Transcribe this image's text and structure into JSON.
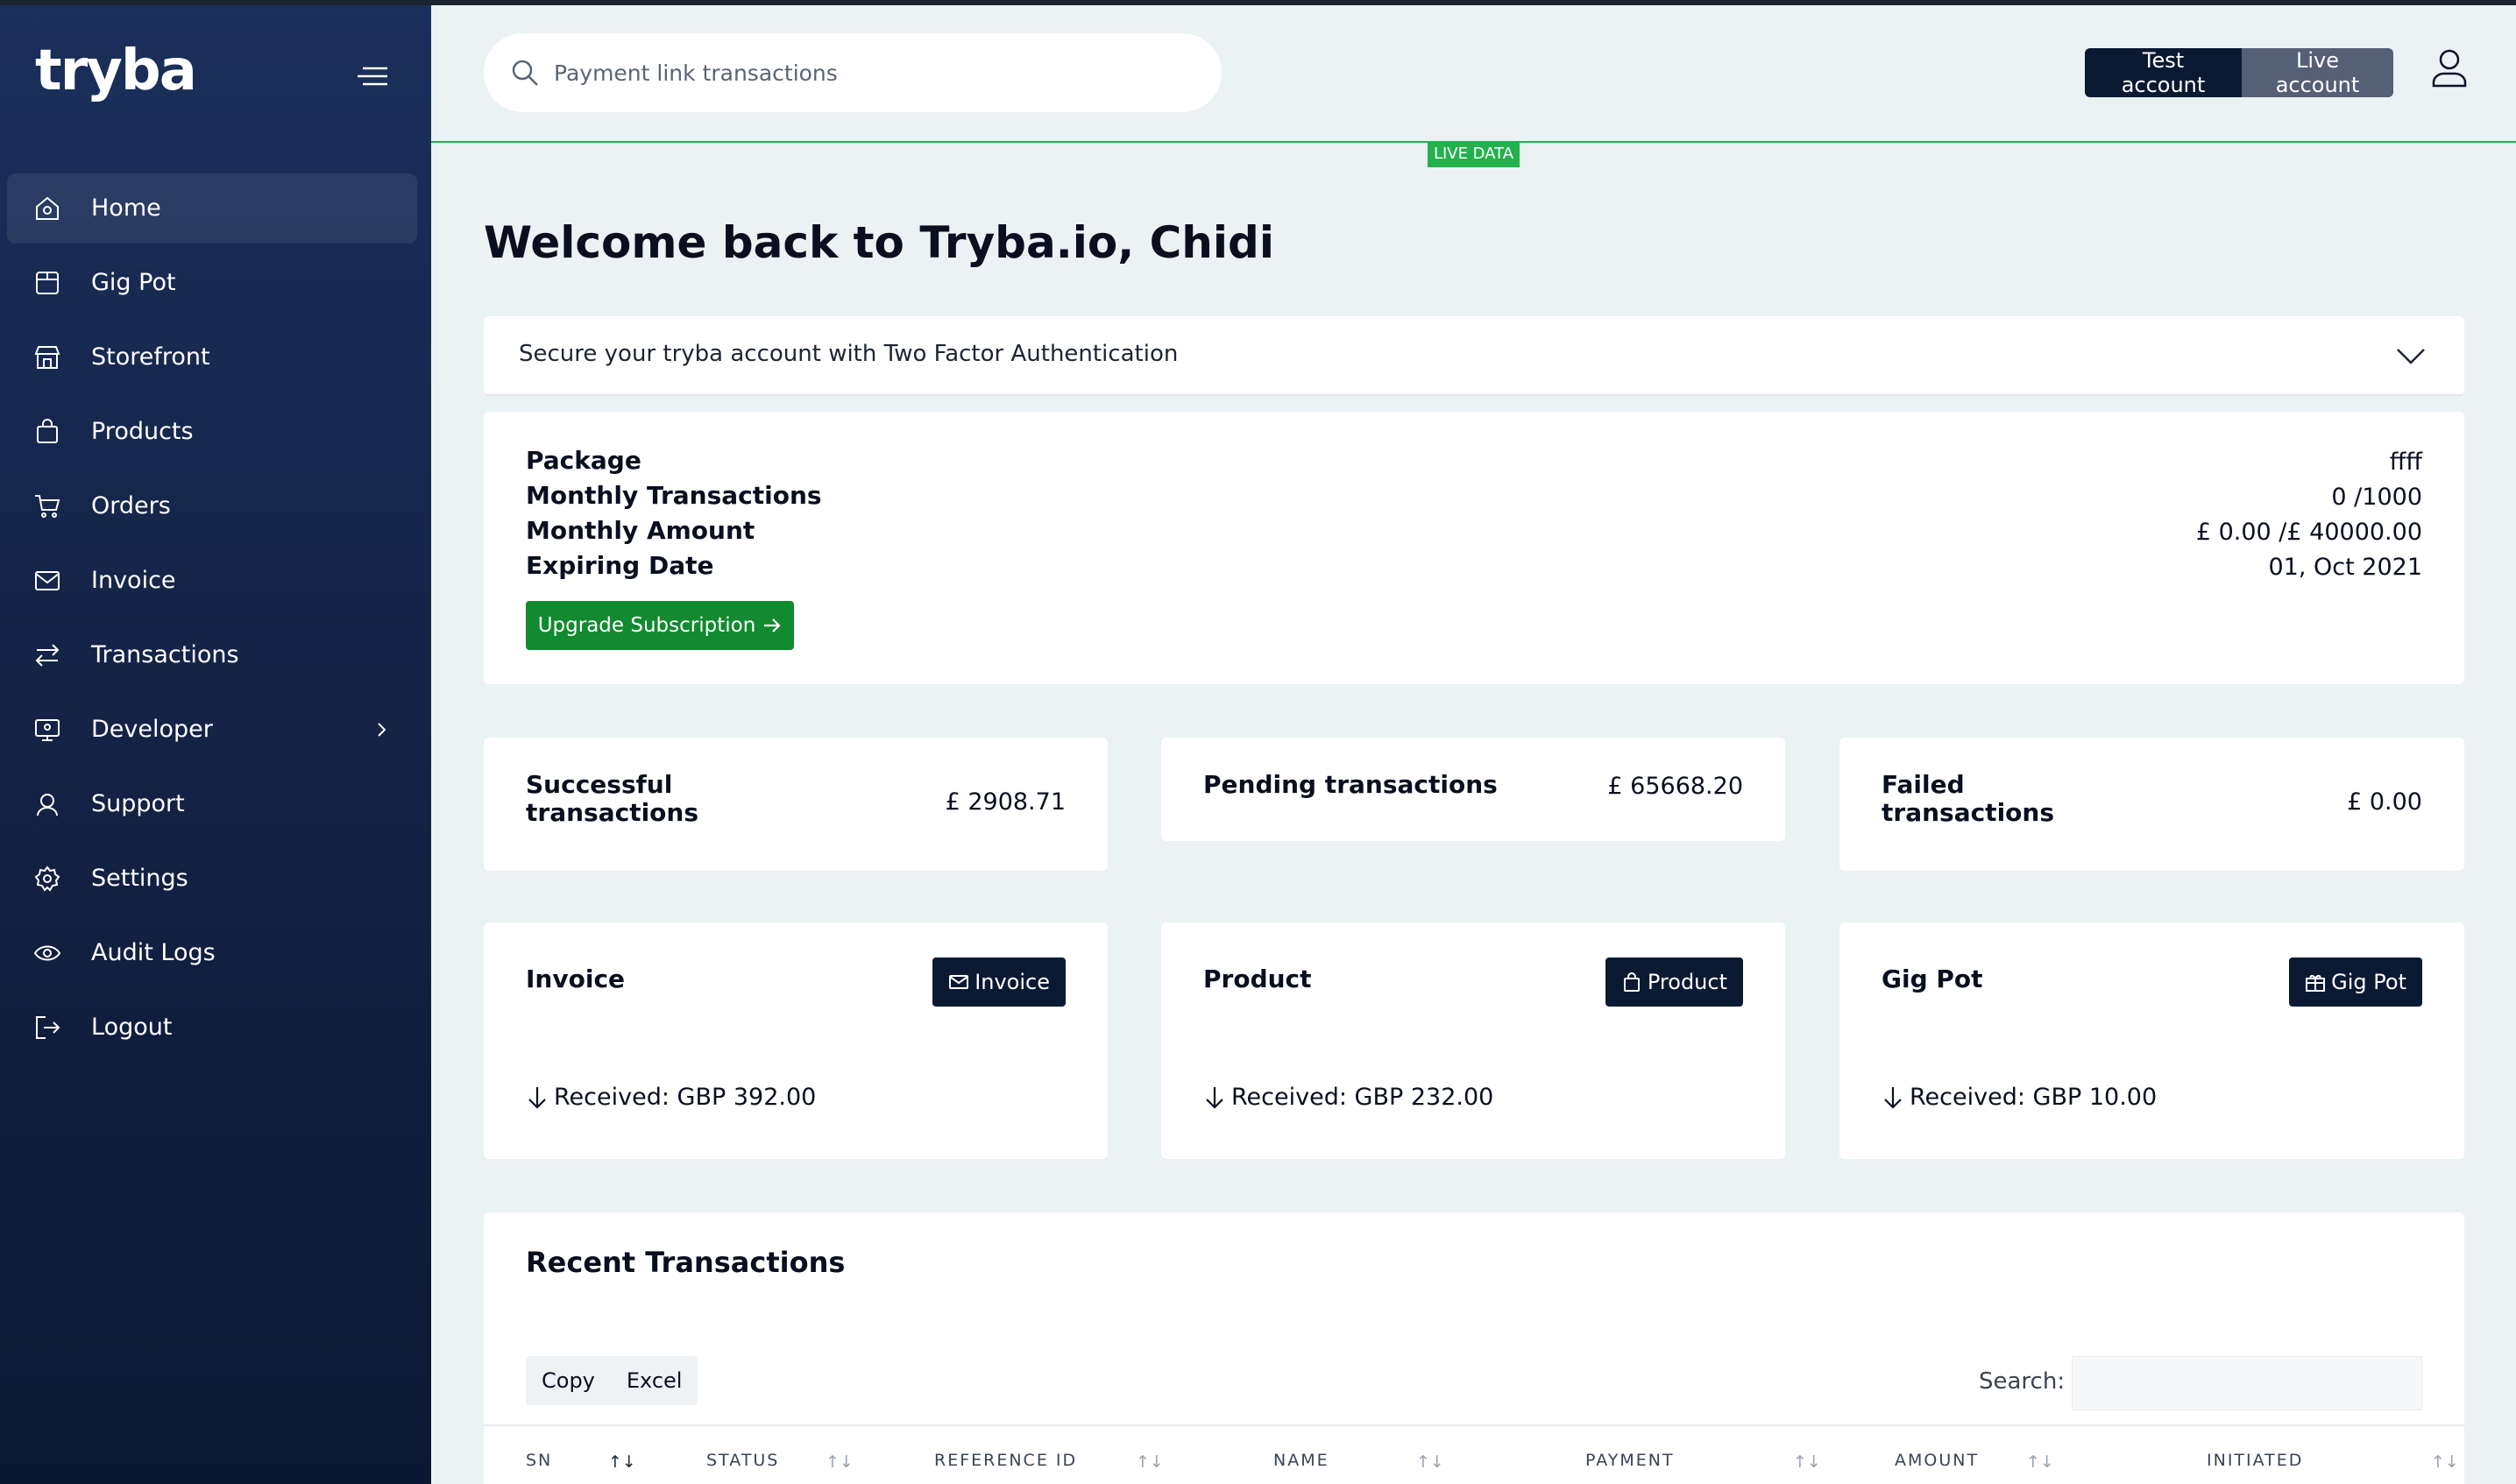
{
  "app": {
    "logo_text": "tryba"
  },
  "sidebar": {
    "items": [
      {
        "label": "Home",
        "icon": "home-icon",
        "active": true
      },
      {
        "label": "Gig Pot",
        "icon": "gig-pot-icon"
      },
      {
        "label": "Storefront",
        "icon": "storefront-icon"
      },
      {
        "label": "Products",
        "icon": "shopping-bag-icon"
      },
      {
        "label": "Orders",
        "icon": "cart-icon"
      },
      {
        "label": "Invoice",
        "icon": "envelope-icon"
      },
      {
        "label": "Transactions",
        "icon": "transfer-arrows-icon"
      },
      {
        "label": "Developer",
        "icon": "developer-icon",
        "has_submenu": true
      },
      {
        "label": "Support",
        "icon": "support-icon"
      },
      {
        "label": "Settings",
        "icon": "gear-icon"
      },
      {
        "label": "Audit Logs",
        "icon": "eye-icon"
      },
      {
        "label": "Logout",
        "icon": "logout-icon"
      }
    ]
  },
  "header": {
    "search_placeholder": "Payment link transactions",
    "test_account_label": "Test account",
    "live_account_label": "Live account",
    "live_tag": "LIVE DATA"
  },
  "main": {
    "welcome": "Welcome back to Tryba.io, Chidi",
    "two_factor_prompt": "Secure your tryba account with Two Factor Authentication",
    "package": {
      "labels": [
        "Package",
        "Monthly Transactions",
        "Monthly Amount",
        "Expiring Date"
      ],
      "values": [
        "ffff",
        "0 /1000",
        "£ 0.00 /£ 40000.00",
        "01, Oct 2021"
      ],
      "upgrade_label": "Upgrade Subscription"
    },
    "stats": {
      "successful": {
        "label_line1": "Successful",
        "label_line2": "transactions",
        "value": "£ 2908.71"
      },
      "pending": {
        "label": "Pending transactions",
        "value": "£ 65668.20"
      },
      "failed": {
        "label_line1": "Failed",
        "label_line2": "transactions",
        "value": "£ 0.00"
      }
    },
    "features": {
      "invoice": {
        "title": "Invoice",
        "button": "Invoice",
        "received": "Received: GBP 392.00"
      },
      "product": {
        "title": "Product",
        "button": "Product",
        "received": "Received: GBP 232.00"
      },
      "gigpot": {
        "title": "Gig Pot",
        "button": "Gig Pot",
        "received": "Received: GBP 10.00"
      }
    },
    "recent": {
      "title": "Recent Transactions",
      "copy_label": "Copy",
      "excel_label": "Excel",
      "search_label": "Search:",
      "columns": [
        "SN",
        "STATUS",
        "REFERENCE ID",
        "NAME",
        "PAYMENT",
        "AMOUNT",
        "INITIATED"
      ]
    }
  },
  "colors": {
    "sidebar_top": "#1a2f5a",
    "sidebar_bottom": "#0c1733",
    "accent_green": "#128a2f",
    "live_green": "#23b14d",
    "dark_button": "#0b1a33",
    "page_bg": "#eaf2f4"
  }
}
